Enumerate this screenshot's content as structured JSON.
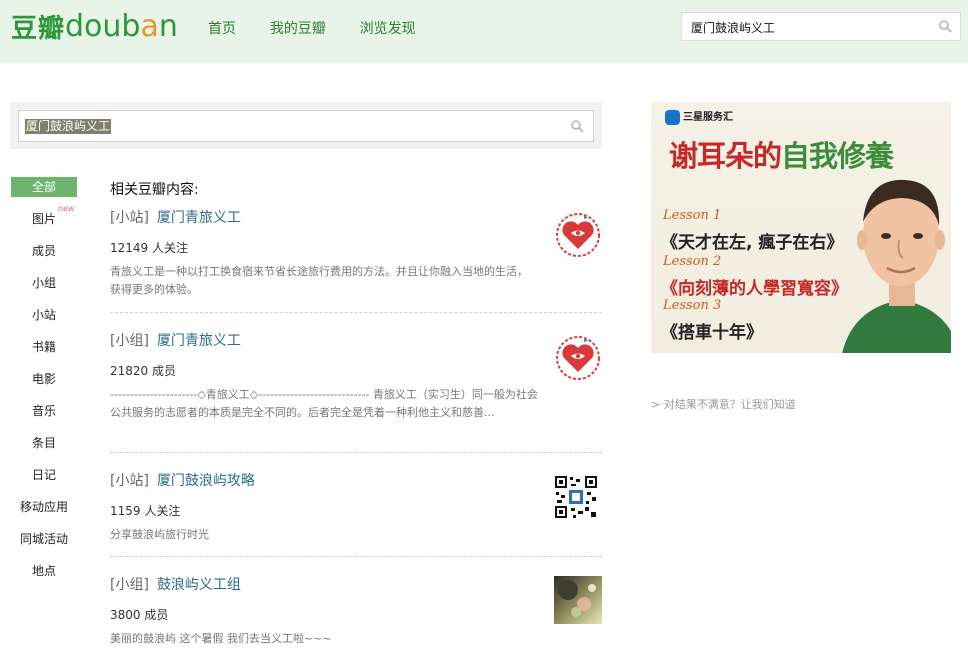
{
  "header": {
    "logo_cn": "豆瓣",
    "logo_en_pre": "doub",
    "logo_en_a": "a",
    "logo_en_post": "n",
    "nav": [
      "首页",
      "我的豆瓣",
      "浏览发现"
    ],
    "search_value": "厦门鼓浪屿义工"
  },
  "search": {
    "value": "厦门鼓浪屿义工"
  },
  "filters": [
    {
      "label": "全部",
      "active": true
    },
    {
      "label": "图片",
      "badge": "new"
    },
    {
      "label": "成员"
    },
    {
      "label": "小组"
    },
    {
      "label": "小站"
    },
    {
      "label": "书籍"
    },
    {
      "label": "电影"
    },
    {
      "label": "音乐"
    },
    {
      "label": "条目"
    },
    {
      "label": "日记"
    },
    {
      "label": "移动应用"
    },
    {
      "label": "同城活动"
    },
    {
      "label": "地点"
    }
  ],
  "results_heading": "相关豆瓣内容:",
  "results": [
    {
      "tag": "[小站]",
      "name": "厦门青旅义工",
      "meta": "12149 人关注",
      "desc": "青旅义工是一种以打工换食宿来节省长途旅行费用的方法。并且让你融入当地的生活，获得更多的体验。"
    },
    {
      "tag": "[小组]",
      "name": "厦门青旅义工",
      "meta": "21820 成员",
      "desc": "----------------------◇青旅义工◇---------------------------- 青旅义工（实习生）同一般为社会公共服务的志愿者的本质是完全不同的。后者完全是凭着一种利他主义和慈善..."
    },
    {
      "tag": "[小站]",
      "name": "厦门鼓浪屿攻略",
      "meta": "1159 人关注",
      "desc": "分享鼓浪屿旅行时光"
    },
    {
      "tag": "[小组]",
      "name": "鼓浪屿义工组",
      "meta": "3800 成员",
      "desc": "美丽的鼓浪屿 这个暑假 我们去当义工啦~~~"
    }
  ],
  "ad": {
    "brand": "三星服务汇",
    "headline_a": "谢耳朵的",
    "headline_b": "自我修養",
    "lessons": [
      {
        "label": "Lesson 1",
        "text": "《天才在左, 瘋子在右》"
      },
      {
        "label": "Lesson 2",
        "text": "《向刻薄的人學習寬容》"
      },
      {
        "label": "Lesson 3",
        "text": "《搭車十年》"
      }
    ]
  },
  "feedback": "> 对结果不满意？让我们知道",
  "colors": {
    "brand_green": "#2e963d",
    "link_blue": "#2e6a8d",
    "active_filter": "#6cb46c"
  }
}
